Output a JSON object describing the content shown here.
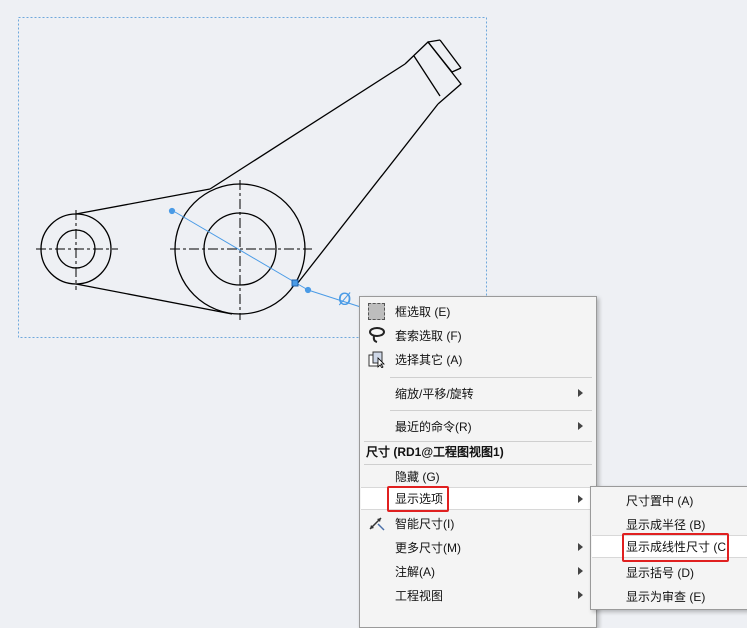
{
  "dimension_symbol": "Ø",
  "menu": {
    "box_select": "框选取 (E)",
    "lasso_select": "套索选取 (F)",
    "select_other": "选择其它 (A)",
    "zoom_pan_rotate": "缩放/平移/旋转",
    "recent_commands": "最近的命令(R)",
    "section_header": "尺寸 (RD1@工程图视图1)",
    "hide": "隐藏 (G)",
    "display_options": "显示选项",
    "smart_dimension": "智能尺寸(I)",
    "more_dimensions": "更多尺寸(M)",
    "annotations": "注解(A)",
    "drawing_views": "工程视图"
  },
  "submenu": {
    "center_dimension": "尺寸置中 (A)",
    "show_as_radius": "显示成半径 (B)",
    "show_as_linear": "显示成线性尺寸 (C",
    "show_parentheses": "显示括号 (D)",
    "show_as_inspection": "显示为审查 (E)"
  },
  "colors": {
    "highlight_box": "#e02020",
    "dimension_line": "#4a9be6",
    "view_border": "#6fa8dc"
  }
}
